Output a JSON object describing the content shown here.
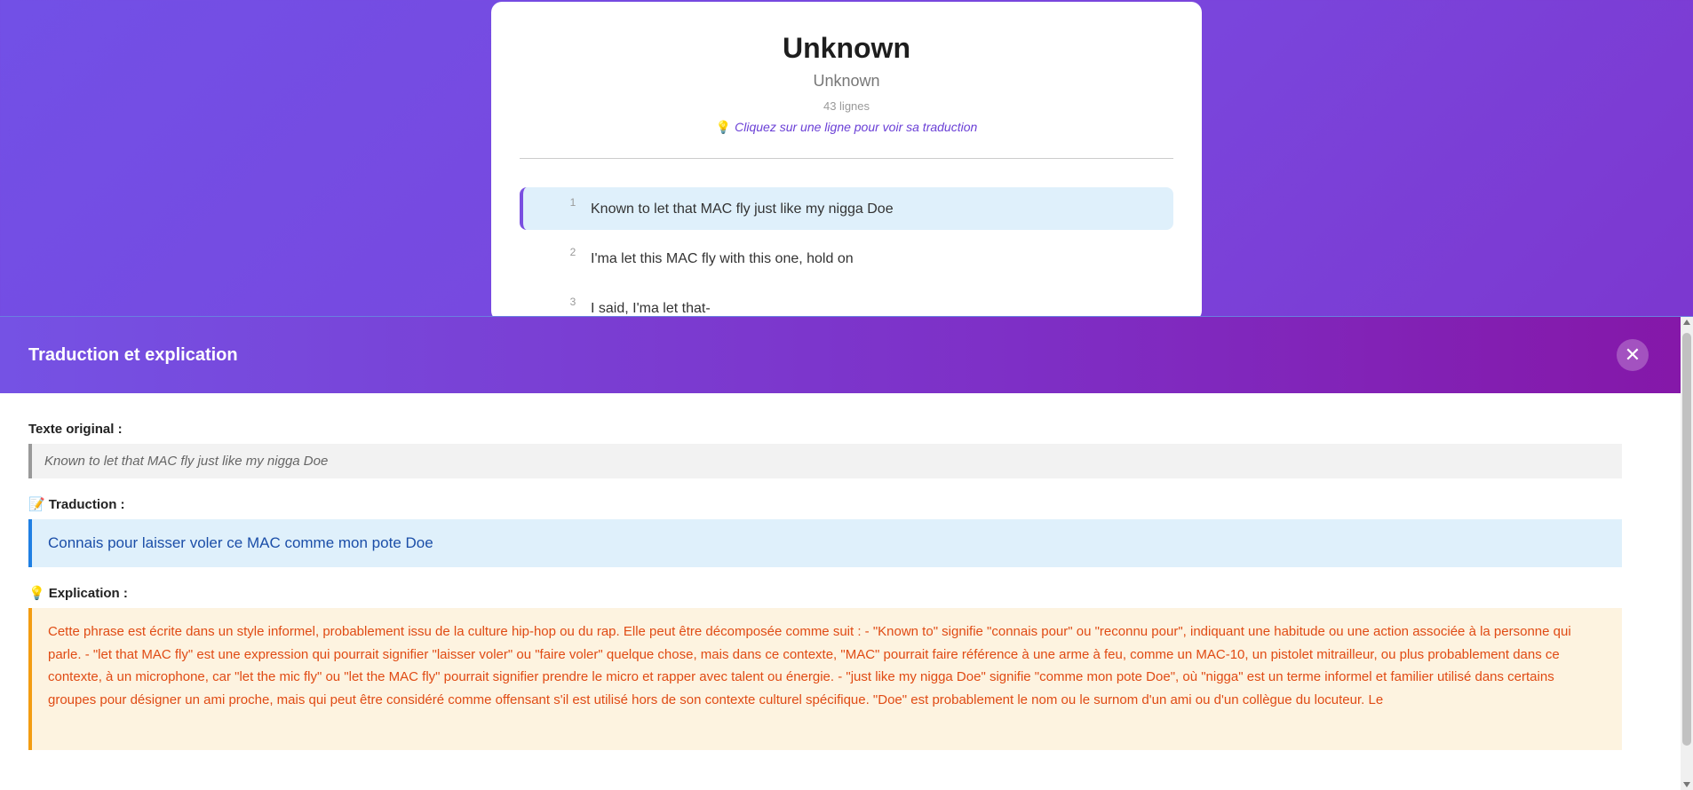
{
  "song": {
    "title": "Unknown",
    "artist": "Unknown",
    "line_count": "43 lignes",
    "hint_icon": "💡",
    "hint": "Cliquez sur une ligne pour voir sa traduction"
  },
  "lyrics": [
    {
      "num": "1",
      "text": "Known to let that MAC fly just like my nigga Doe",
      "active": true
    },
    {
      "num": "2",
      "text": "I'ma let this MAC fly with this one, hold on",
      "active": false
    },
    {
      "num": "3",
      "text": "I said, I'ma let that-",
      "active": false
    }
  ],
  "panel": {
    "title": "Traduction et explication",
    "close_icon": "✕",
    "original_label": "Texte original :",
    "original_text": "Known to let that MAC fly just like my nigga Doe",
    "translation_icon": "📝",
    "translation_label": "Traduction :",
    "translation_text": "Connais pour laisser voler ce MAC comme mon pote Doe",
    "explanation_icon": "💡",
    "explanation_label": "Explication :",
    "explanation_text": "Cette phrase est écrite dans un style informel, probablement issu de la culture hip-hop ou du rap. Elle peut être décomposée comme suit : - \"Known to\" signifie \"connais pour\" ou \"reconnu pour\", indiquant une habitude ou une action associée à la personne qui parle. - \"let that MAC fly\" est une expression qui pourrait signifier \"laisser voler\" ou \"faire voler\" quelque chose, mais dans ce contexte, \"MAC\" pourrait faire référence à une arme à feu, comme un MAC-10, un pistolet mitrailleur, ou plus probablement dans ce contexte, à un microphone, car \"let the mic fly\" ou \"let the MAC fly\" pourrait signifier prendre le micro et rapper avec talent ou énergie. - \"just like my nigga Doe\" signifie \"comme mon pote Doe\", où \"nigga\" est un terme informel et familier utilisé dans certains groupes pour désigner un ami proche, mais qui peut être considéré comme offensant s'il est utilisé hors de son contexte culturel spécifique. \"Doe\" est probablement le nom ou le surnom d'un ami ou d'un collègue du locuteur. Le"
  },
  "colors": {
    "accent": "#7250e6",
    "active_line_bg": "#dff0fb",
    "translation_border": "#1f7fe3",
    "explanation_border": "#f39c12",
    "explanation_text": "#e04b14"
  }
}
